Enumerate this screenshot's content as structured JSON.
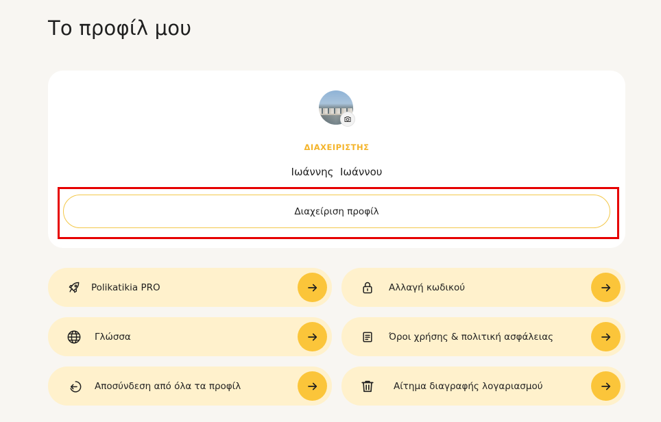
{
  "page": {
    "title": "Το προφίλ μου"
  },
  "profile": {
    "role": "ΔΙΑΧΕΙΡΙΣΤΗΣ",
    "name": "Ιωάννης  Ιωάννου",
    "manage_label": "Διαχείριση προφίλ",
    "avatar_icon": "user-photo",
    "camera_icon": "camera-icon"
  },
  "menu": {
    "items": [
      {
        "label": "Polikatikia PRO",
        "icon": "rocket-icon"
      },
      {
        "label": "Αλλαγή κωδικού",
        "icon": "lock-icon"
      },
      {
        "label": "Γλώσσα",
        "icon": "globe-icon"
      },
      {
        "label": "Όροι χρήσης & πολιτική ασφάλειας",
        "icon": "document-icon"
      },
      {
        "label": "Αποσύνδεση από όλα τα προφίλ",
        "icon": "logout-icon"
      },
      {
        "label": "Αίτημα διαγραφής λογαριασμού",
        "icon": "trash-icon"
      }
    ]
  },
  "colors": {
    "accent": "#fbc53a",
    "role": "#f4b42a",
    "item_bg": "#fff1cc",
    "highlight": "#e60000"
  }
}
